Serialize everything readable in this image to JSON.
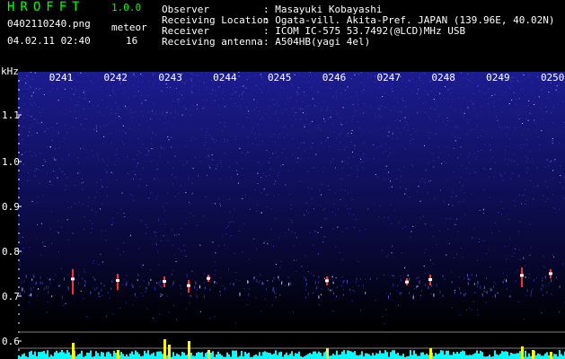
{
  "app": {
    "name": "HROFFT",
    "version": "1.0.0"
  },
  "file": {
    "name": "0402110240.png",
    "datetime": "04.02.11 02:40"
  },
  "meteor": {
    "label": "meteor",
    "count": "16"
  },
  "info": [
    {
      "label": "Observer",
      "value": ": Masayuki Kobayashi"
    },
    {
      "label": "Receiving Location",
      "value": ": Ogata-vill. Akita-Pref. JAPAN (139.96E, 40.02N)"
    },
    {
      "label": "Receiver",
      "value": ": ICOM IC-575 53.7492(@LCD)MHz USB"
    },
    {
      "label": "Receiving antenna",
      "value": ": A504HB(yagi 4el)"
    }
  ],
  "axis": {
    "y_unit": "kHz",
    "y_ticks": [
      "1.1",
      "1.0",
      "0.9",
      "0.8",
      "0.7",
      "0.6"
    ],
    "x_ticks": [
      "0241",
      "0242",
      "0243",
      "0244",
      "0245",
      "0246",
      "0247",
      "0248",
      "0249",
      "0250"
    ]
  },
  "colors": {
    "title": "#00ff00",
    "text": "#ffffff",
    "background": "#000000",
    "noise": "#1a1a8a",
    "echo_hot": "#ff3030",
    "signal_bar": "#ffff00",
    "baseline_bar": "#00ffff",
    "grid_line": "#808080"
  }
}
